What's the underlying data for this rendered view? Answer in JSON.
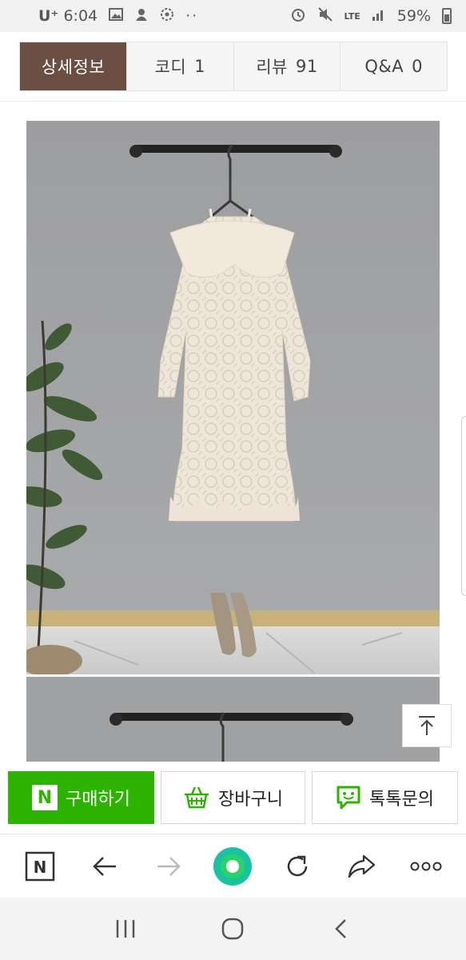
{
  "status_bar": {
    "carrier": "U⁺",
    "time": "6:04",
    "network": "LTE",
    "battery": "59%"
  },
  "tabs": [
    {
      "label": "상세정보",
      "count": ""
    },
    {
      "label": "코디",
      "count": "1"
    },
    {
      "label": "리뷰",
      "count": "91"
    },
    {
      "label": "Q&A",
      "count": "0"
    }
  ],
  "actions": {
    "buy_logo": "N",
    "buy": "구매하기",
    "cart": "장바구니",
    "talk": "톡톡문의"
  },
  "browser_toolbar": {
    "home_logo": "N",
    "icons": [
      "naver-home-icon",
      "back-arrow-icon",
      "forward-arrow-icon",
      "green-dot-icon",
      "reload-icon",
      "share-icon",
      "more-icon"
    ]
  },
  "colors": {
    "active_tab": "#6b4f42",
    "buy_green": "#2db400",
    "accent_teal": "#19c3a0"
  }
}
